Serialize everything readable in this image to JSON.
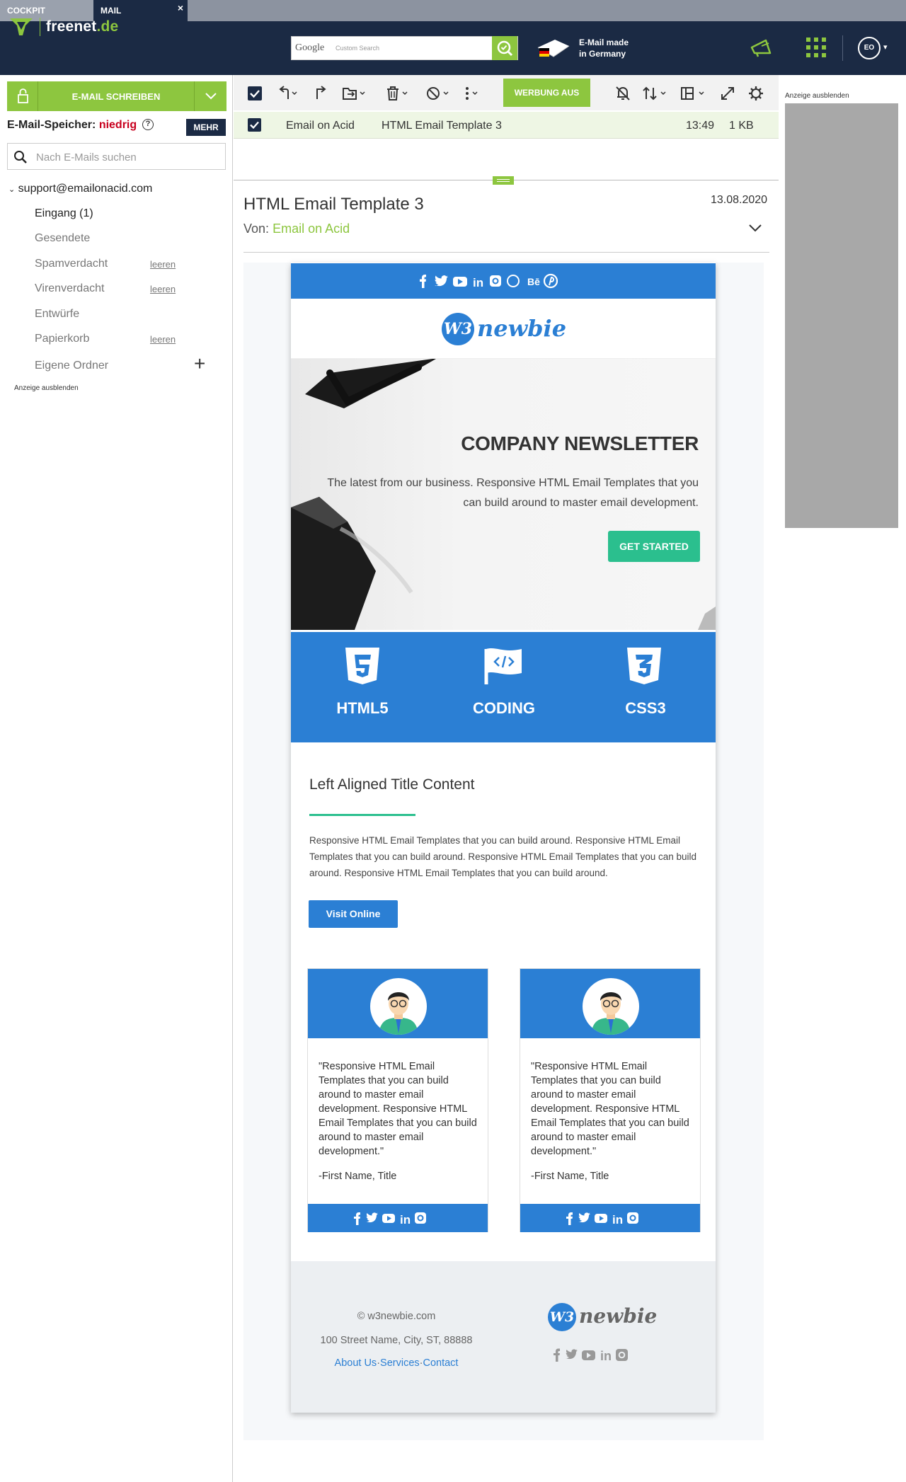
{
  "tabs": {
    "cockpit": "COCKPIT",
    "mail": "MAIL",
    "close": "×"
  },
  "header": {
    "brand": "freenet",
    "brand_tld": ".de",
    "search_brand": "Google",
    "search_placeholder": "Custom Search",
    "made_line1": "E-Mail made",
    "made_line2": "in Germany",
    "avatar_initials": "EO"
  },
  "sidebar": {
    "compose_label": "E-MAIL SCHREIBEN",
    "storage_label": "E-Mail-Speicher:",
    "storage_level": "niedrig",
    "more_label": "MEHR",
    "search_placeholder": "Nach E-Mails suchen",
    "account": "support@emailonacid.com",
    "folders": [
      {
        "label": "Eingang (1)",
        "action": ""
      },
      {
        "label": "Gesendete",
        "action": ""
      },
      {
        "label": "Spamverdacht",
        "action": "leeren"
      },
      {
        "label": "Virenverdacht",
        "action": "leeren"
      },
      {
        "label": "Entwürfe",
        "action": ""
      },
      {
        "label": "Papierkorb",
        "action": "leeren"
      },
      {
        "label": "Eigene Ordner",
        "action": ""
      }
    ],
    "ad_hide": "Anzeige ausblenden"
  },
  "toolbar": {
    "ad_off_label": "WERBUNG AUS"
  },
  "message_row": {
    "from": "Email on Acid",
    "subject": "HTML Email Template 3",
    "time": "13:49",
    "size": "1 KB"
  },
  "mail": {
    "title": "HTML Email Template 3",
    "date": "13.08.2020",
    "from_label": "Von:",
    "from_name": "Email on Acid"
  },
  "right_ad": {
    "hide_label": "Anzeige ausblenden"
  },
  "email": {
    "logo_w3": "W3",
    "logo_text": "newbie",
    "hero_title": "COMPANY NEWSLETTER",
    "hero_text": "The latest from our business. Responsive HTML Email Templates that you can build around to master email development.",
    "hero_button": "GET STARTED",
    "features": [
      "HTML5",
      "CODING",
      "CSS3"
    ],
    "section_title": "Left Aligned Title Content",
    "section_text": "Responsive HTML Email Templates that you can build around. Responsive HTML Email Templates that you can build around. Responsive HTML Email Templates that you can build around. Responsive HTML Email Templates that you can build around.",
    "visit_button": "Visit Online",
    "cards": [
      {
        "quote": "\"Responsive HTML Email Templates that you can build around to master email development. Responsive HTML Email Templates that you can build around to master email development.\"",
        "signature": "-First Name, Title"
      },
      {
        "quote": "\"Responsive HTML Email Templates that you can build around to master email development. Responsive HTML Email Templates that you can build around to master email development.\"",
        "signature": "-First Name, Title"
      }
    ],
    "footer_copy": "© w3newbie.com",
    "footer_address": "100 Street Name, City, ST, 88888",
    "footer_links": [
      "About Us",
      "Services",
      "Contact"
    ],
    "footer_link_sep": "·"
  },
  "colors": {
    "brand_green": "#8dc63f",
    "navy": "#1b2a44",
    "email_blue": "#2b7fd4",
    "teal": "#2bbf8e",
    "alert_red": "#c8001e"
  }
}
